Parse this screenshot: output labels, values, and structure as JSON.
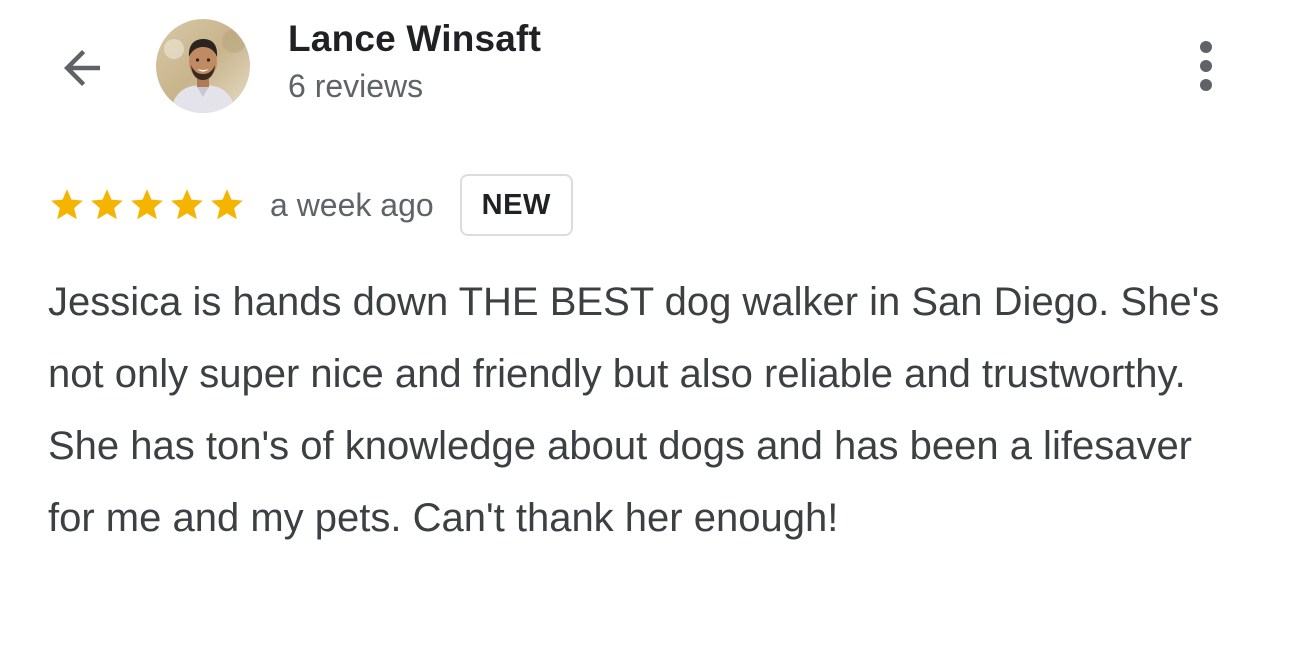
{
  "reviewer": {
    "name": "Lance Winsaft",
    "review_count": "6 reviews"
  },
  "review": {
    "rating": 5,
    "max_rating": 5,
    "date": "a week ago",
    "badge": "NEW",
    "text": "Jessica is hands down THE BEST dog walker in San Diego. She's not only super nice and friendly but also reliable and trustworthy. She has ton's of knowledge about dogs and has been a lifesaver for me and my pets. Can't thank her enough!"
  },
  "icons": {
    "back": "arrow-back-icon",
    "more": "more-vert-icon",
    "star": "star-icon"
  },
  "colors": {
    "star": "#f4b400",
    "name": "#202124",
    "secondary_text": "#5f6368",
    "body_text": "#3c4043",
    "badge_border": "#dadce0"
  }
}
